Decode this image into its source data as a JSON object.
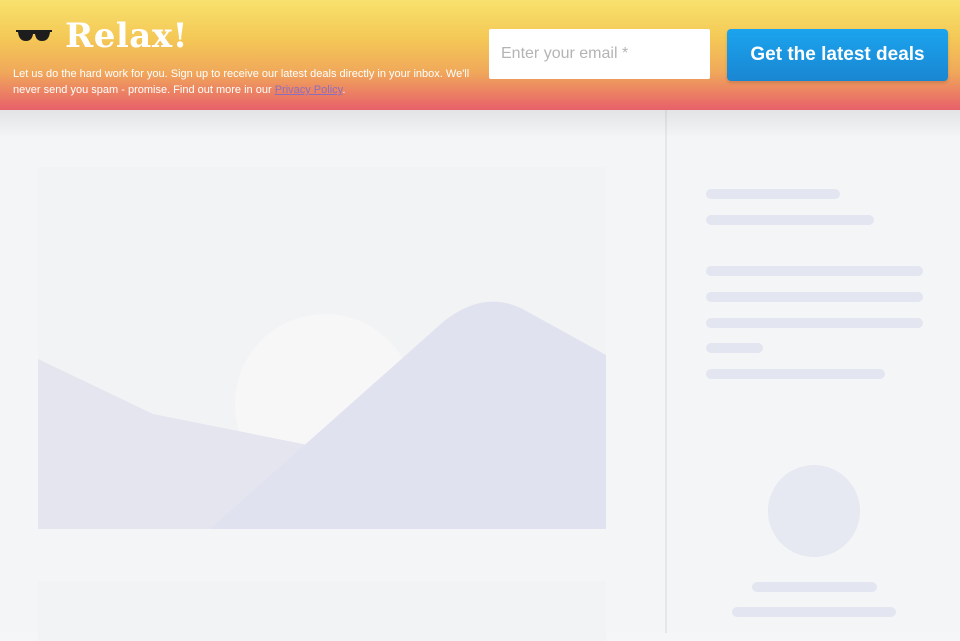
{
  "banner": {
    "title": "Relax!",
    "icon": "sunglasses-icon",
    "blurb_text": "Let us do the hard work for you. Sign up to receive our latest deals directly in your inbox. We'll never send you spam - promise. Find out more in our ",
    "privacy_link": "Privacy Policy",
    "blurb_end": ".",
    "email_placeholder": "Enter your email *",
    "cta_label": "Get the latest deals",
    "colors": {
      "gradient_top": "#f8e16d",
      "gradient_bottom": "#e8606a",
      "cta": "#1a86d2"
    }
  },
  "page": {
    "state": "loading-skeleton"
  }
}
